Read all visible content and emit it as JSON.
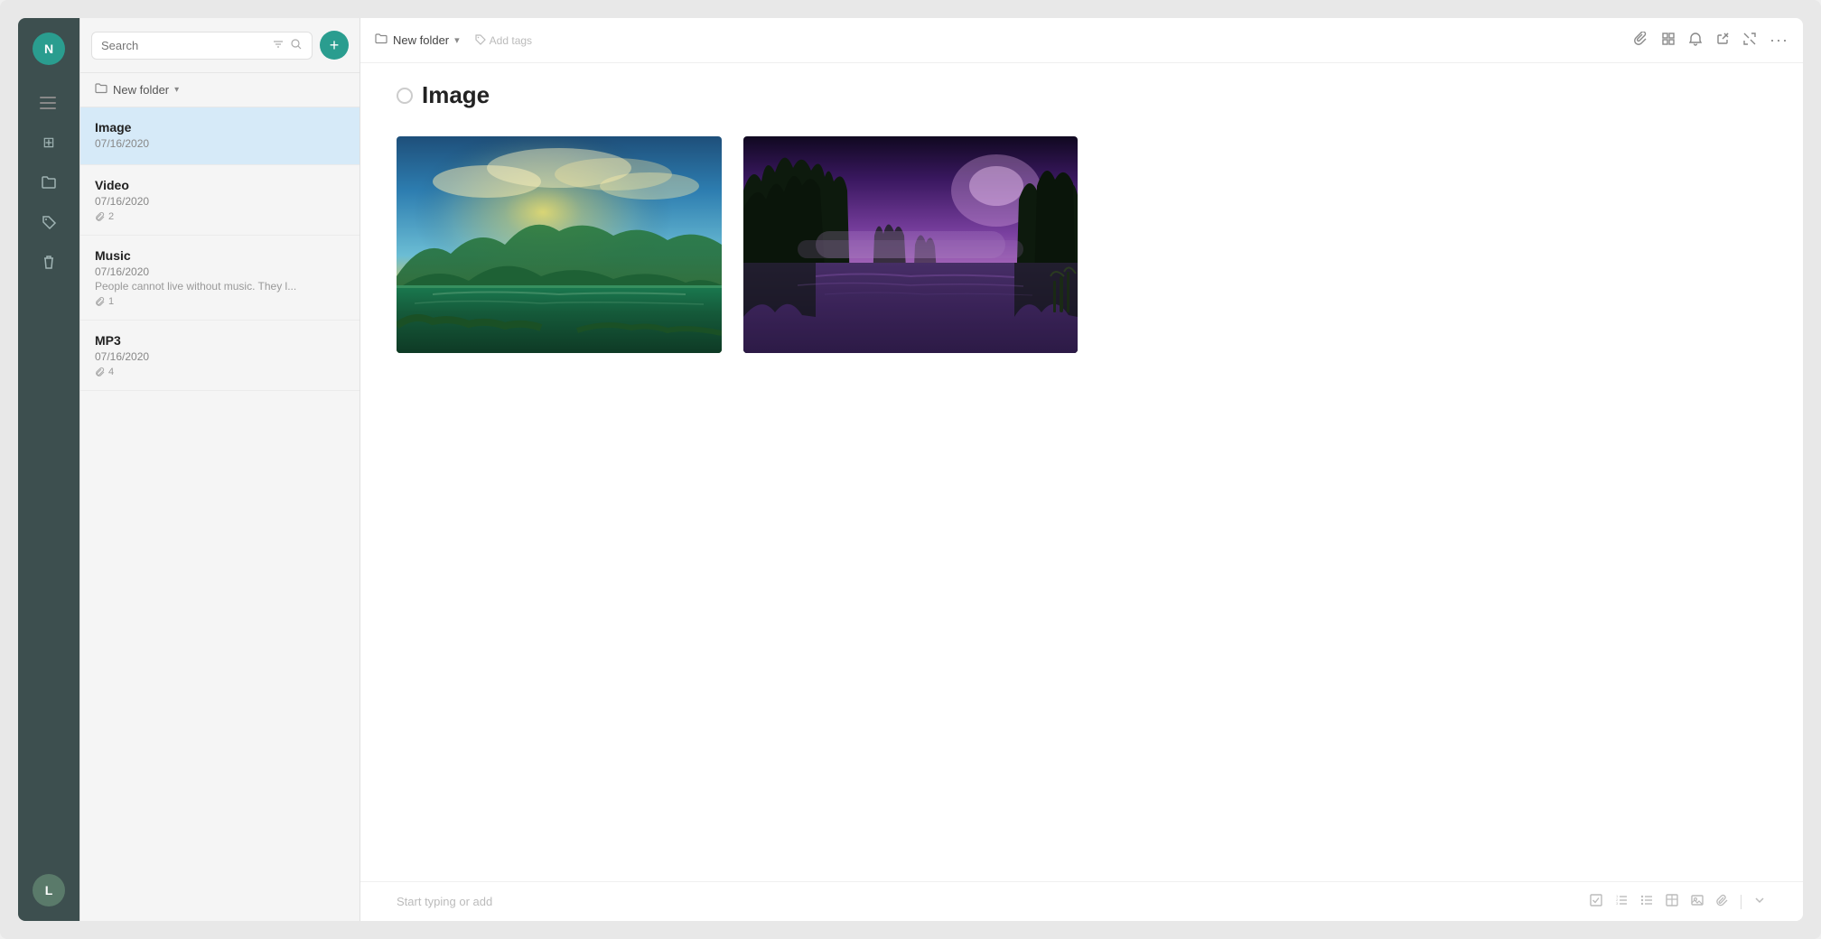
{
  "rail": {
    "menu_icon": "≡",
    "avatar_top": "N",
    "avatar_bottom": "L",
    "icons": [
      {
        "name": "grid-icon",
        "symbol": "⊞"
      },
      {
        "name": "folder-icon",
        "symbol": "📁"
      },
      {
        "name": "tag-icon",
        "symbol": "🏷"
      },
      {
        "name": "trash-icon",
        "symbol": "🗑"
      }
    ]
  },
  "sidebar": {
    "search_placeholder": "Search",
    "add_button_label": "+",
    "folder": {
      "icon": "📁",
      "name": "New folder",
      "chevron": "▾"
    },
    "notes": [
      {
        "title": "Image",
        "date": "07/16/2020",
        "excerpt": "",
        "attachments": null,
        "active": true
      },
      {
        "title": "Video",
        "date": "07/16/2020",
        "excerpt": "",
        "attachments": "2",
        "active": false
      },
      {
        "title": "Music",
        "date": "07/16/2020",
        "excerpt": "People cannot live without music. They l...",
        "attachments": "1",
        "active": false
      },
      {
        "title": "MP3",
        "date": "07/16/2020",
        "excerpt": "",
        "attachments": "4",
        "active": false
      }
    ]
  },
  "topbar": {
    "folder_icon": "📁",
    "folder_name": "New folder",
    "folder_chevron": "▾",
    "tags_icon": "🏷",
    "tags_label": "Add tags",
    "actions": [
      {
        "name": "attach-icon",
        "symbol": "📎"
      },
      {
        "name": "grid-view-icon",
        "symbol": "⊞"
      },
      {
        "name": "bell-icon",
        "symbol": "🔔"
      },
      {
        "name": "share-icon",
        "symbol": "⇗"
      },
      {
        "name": "expand-icon",
        "symbol": "⤢"
      },
      {
        "name": "more-icon",
        "symbol": "…"
      }
    ]
  },
  "note": {
    "title": "Image",
    "status_circle": "○",
    "images": [
      {
        "alt": "Sunny mountain lake landscape",
        "type": "img1"
      },
      {
        "alt": "Purple forest lake landscape",
        "type": "img2"
      }
    ]
  },
  "editor": {
    "placeholder": "Start typing or add",
    "toolbar_icons": [
      {
        "name": "checkbox-icon",
        "symbol": "☑"
      },
      {
        "name": "ordered-list-icon",
        "symbol": "≡"
      },
      {
        "name": "unordered-list-icon",
        "symbol": "☰"
      },
      {
        "name": "table-icon",
        "symbol": "⊞"
      },
      {
        "name": "image-icon",
        "symbol": "🖼"
      },
      {
        "name": "attach-icon",
        "symbol": "📎"
      },
      {
        "name": "chevron-down-icon",
        "symbol": "▾"
      }
    ]
  }
}
